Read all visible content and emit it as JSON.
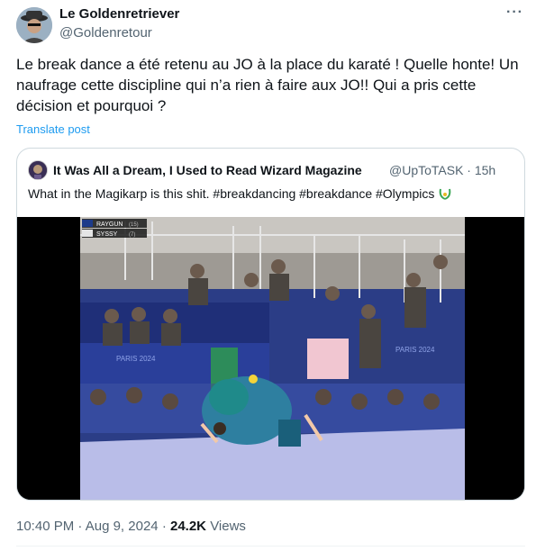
{
  "author": {
    "display_name": "Le Goldenretriever",
    "handle": "@Goldenretour",
    "avatar_icon": "user-avatar-icon"
  },
  "more_icon": "more-options-icon",
  "tweet": {
    "text": "Le break dance a été retenu au JO à la place du karaté ! Quelle honte! Un naufrage cette discipline qui n’a rien à faire aux JO!! Qui a pris cette décision et pourquoi ?",
    "translate_label": "Translate post"
  },
  "quote": {
    "display_name": "It Was All a Dream, I Used to Read Wizard Magazine",
    "handle_time": "@UpToTASK · 15h",
    "text": "What in the Magikarp is this shit. #breakdancing #breakdance #Olympics",
    "media": {
      "scoreboard": [
        {
          "name": "RAYGUN",
          "score": "(15)"
        },
        {
          "name": "SYSSY",
          "score": "(7)"
        }
      ],
      "banner_text": "PARIS 2024"
    }
  },
  "footer": {
    "time": "10:40 PM",
    "date": "Aug 9, 2024",
    "views_count": "24.2K",
    "views_label": "Views"
  },
  "colors": {
    "link": "#1d9bf0",
    "secondary_text": "#536471",
    "border": "#cfd9de"
  }
}
